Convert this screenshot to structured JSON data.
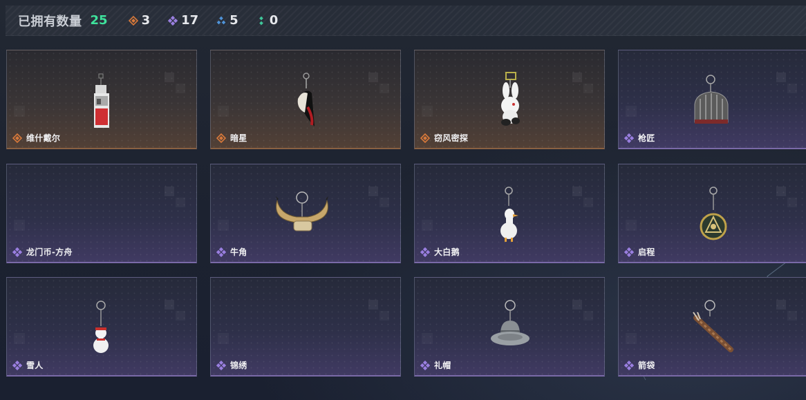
{
  "header": {
    "owned_label": "已拥有数量",
    "owned_count": "25",
    "stats": [
      {
        "icon": "orange-rarity-diamond-icon",
        "color": "#d8793a",
        "value": "3"
      },
      {
        "icon": "purple-rarity-diamond-icon",
        "color": "#9a7fe0",
        "value": "17"
      },
      {
        "icon": "blue-rarity-triangle-icon",
        "color": "#4f93d9",
        "value": "5"
      },
      {
        "icon": "green-rarity-dots-icon",
        "color": "#3fc79a",
        "value": "0"
      }
    ]
  },
  "items": [
    {
      "name": "维什戴尔",
      "rarity": "orange",
      "art": "tag-charm"
    },
    {
      "name": "暗星",
      "rarity": "orange",
      "art": "mask-charm"
    },
    {
      "name": "窃风密探",
      "rarity": "orange",
      "art": "bunny-charm"
    },
    {
      "name": "枪匠",
      "rarity": "purple",
      "art": "cage-charm"
    },
    {
      "name": "龙门币-方舟",
      "rarity": "purple",
      "art": "none"
    },
    {
      "name": "牛角",
      "rarity": "purple",
      "art": "horns-charm"
    },
    {
      "name": "大白鹅",
      "rarity": "purple",
      "art": "goose-charm"
    },
    {
      "name": "启程",
      "rarity": "purple",
      "art": "medal-charm"
    },
    {
      "name": "雪人",
      "rarity": "purple",
      "art": "snowman-charm"
    },
    {
      "name": "锦绣",
      "rarity": "purple",
      "art": "none"
    },
    {
      "name": "礼帽",
      "rarity": "purple",
      "art": "hat-charm"
    },
    {
      "name": "箭袋",
      "rarity": "purple",
      "art": "quiver-charm"
    }
  ],
  "colors": {
    "accent_green": "#3ee29c",
    "orange": "#d8793a",
    "purple": "#9a7fe0"
  }
}
